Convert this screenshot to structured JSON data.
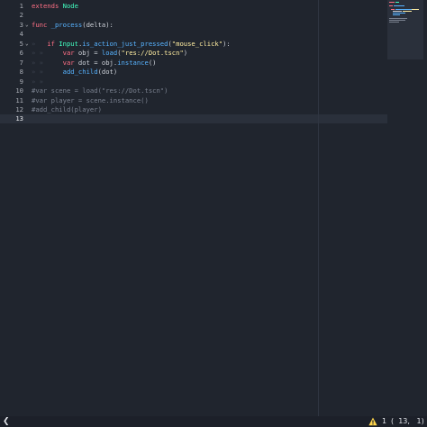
{
  "editor": {
    "line_numbers": [
      "1",
      "2",
      "3",
      "4",
      "5",
      "6",
      "7",
      "8",
      "9",
      "10",
      "11",
      "12",
      "13"
    ],
    "lines": {
      "l1": {
        "kw": "extends",
        "type": "Node"
      },
      "l3": {
        "kw": "func",
        "fn": "_process",
        "rest": "(delta):"
      },
      "l5": {
        "tabs": "»",
        "kw": "if",
        "type": "Input",
        "dot": ".",
        "fn": "is_action_just_pressed",
        "open": "(",
        "str": "\"mouse_click\"",
        "close": "):"
      },
      "l6": {
        "tabs": "» »",
        "kw": "var",
        "mid": " obj = ",
        "fn": "load",
        "open": "(",
        "str": "\"res://Dot.tscn\"",
        "close": ")"
      },
      "l7": {
        "tabs": "» »",
        "kw": "var",
        "mid": " dot = obj.",
        "fn": "instance",
        "close": "()"
      },
      "l8": {
        "tabs": "» »",
        "fn": "add_child",
        "close": "(dot)"
      },
      "l9": {
        "tabs": "» »"
      },
      "l10": {
        "comment": "#var scene = load(\"res://Dot.tscn\")"
      },
      "l11": {
        "comment": "#var player = scene.instance()"
      },
      "l12": {
        "comment": "#add_child(player)"
      }
    },
    "fold_marker": "⌄"
  },
  "statusbar": {
    "toggle_glyph": "❮",
    "warning_count": "1",
    "cursor_position": "(  13,   1)"
  },
  "colors": {
    "background": "#20252e",
    "keyword": "#ff7085",
    "type": "#42ffc2",
    "function": "#57b3ff",
    "string": "#ffeda1",
    "comment": "#7b8290",
    "warning": "#ffd54a"
  }
}
